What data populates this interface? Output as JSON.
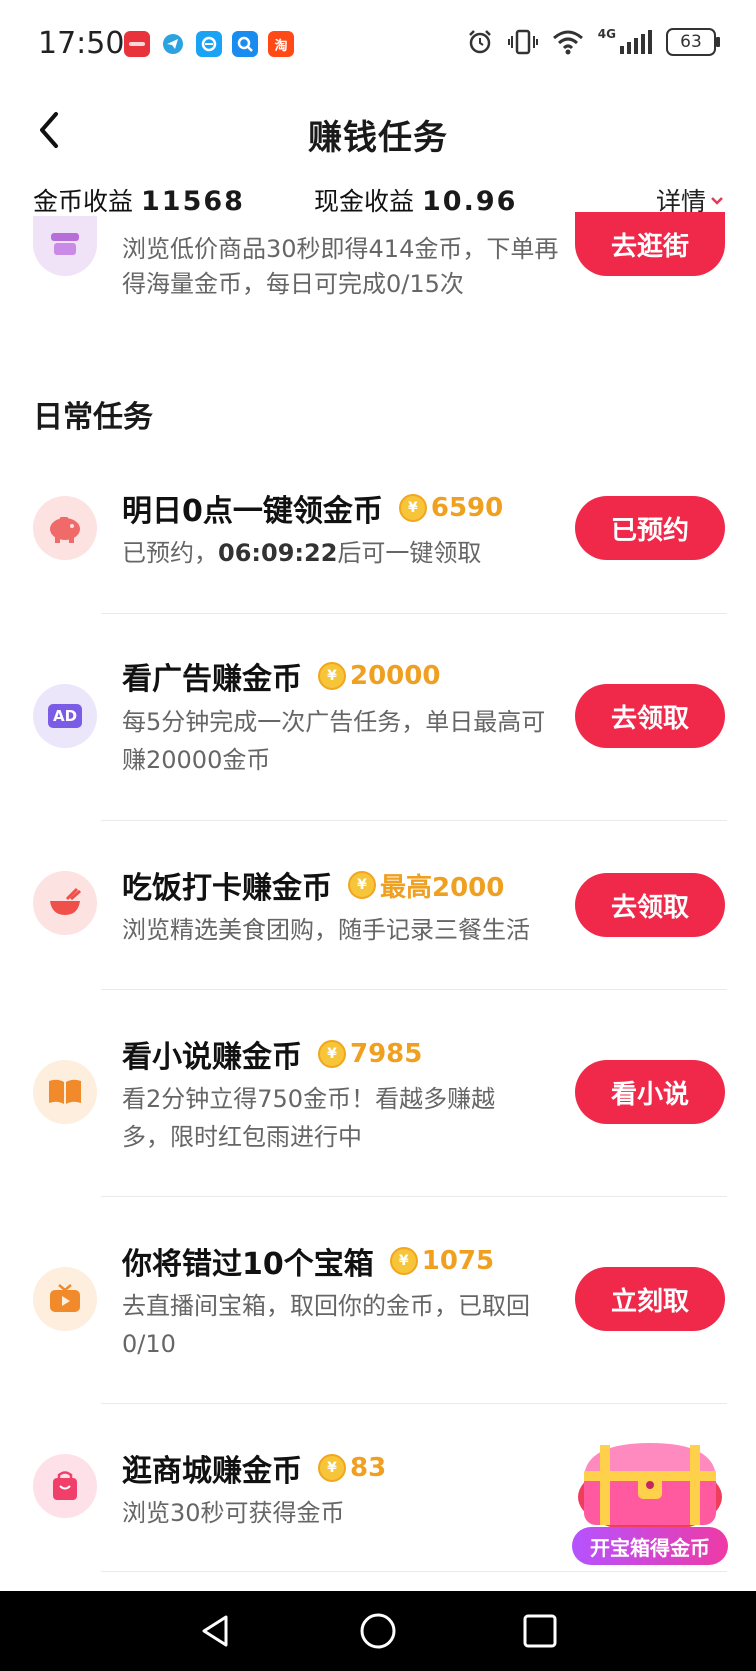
{
  "status_bar": {
    "time": "17:50",
    "battery": "63",
    "network": "4G",
    "app_icons": [
      "huawei-icon",
      "telegram-icon",
      "eleme-icon",
      "search-app-icon",
      "taobao-icon"
    ],
    "app_icon_text": {
      "taobao": "淘"
    }
  },
  "header": {
    "title": "赚钱任务"
  },
  "earnings": {
    "coin_label": "金币收益",
    "coin_value": "11568",
    "cash_label": "现金收益",
    "cash_value": "10.96",
    "detail_label": "详情"
  },
  "partial_task": {
    "desc": "浏览低价商品30秒即得414金币，下单再得海量金币，每日可完成0/15次",
    "button": "去逛街"
  },
  "section_title": "日常任务",
  "tasks": [
    {
      "name": "明日0点一键领金币",
      "reward": "6590",
      "desc_prefix": "已预约，",
      "desc_time": "06:09:22",
      "desc_suffix": "后可一键领取",
      "button": "已预约"
    },
    {
      "name": "看广告赚金币",
      "reward": "20000",
      "desc": "每5分钟完成一次广告任务，单日最高可赚20000金币",
      "button": "去领取",
      "icon_text": "AD"
    },
    {
      "name": "吃饭打卡赚金币",
      "reward": "最高2000",
      "desc": "浏览精选美食团购，随手记录三餐生活",
      "button": "去领取"
    },
    {
      "name": "看小说赚金币",
      "reward": "7985",
      "desc": "看2分钟立得750金币！看越多赚越多，限时红包雨进行中",
      "button": "看小说"
    },
    {
      "name": "你将错过10个宝箱",
      "reward": "1075",
      "desc": "去直播间宝箱，取回你的金币，已取回0/10",
      "button": "立刻取"
    },
    {
      "name": "逛商城赚金币",
      "reward": "83",
      "desc": "浏览30秒可获得金币"
    }
  ],
  "coin_symbol": "¥",
  "treasure": {
    "label": "开宝箱得金币"
  },
  "colors": {
    "accent": "#f0284a",
    "reward": "#f0a020"
  }
}
